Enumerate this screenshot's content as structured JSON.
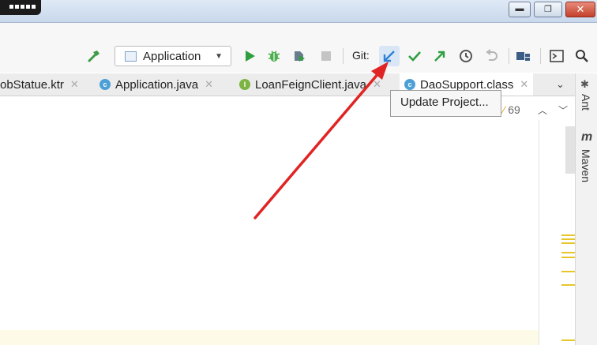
{
  "toolbar": {
    "run_config": "Application",
    "git_label": "Git:",
    "colors": {
      "run": "#2f9e3f",
      "debug": "#4caf50",
      "accent": "#3574d4"
    }
  },
  "icons": {
    "build": "hammer-icon",
    "run": "play-icon",
    "debug": "bug-icon",
    "coverage": "coverage-icon",
    "stop": "stop-icon",
    "update": "vcs-update-icon",
    "commit": "checkmark-icon",
    "push": "push-arrow-icon",
    "history": "history-clock-icon",
    "rollback": "rollback-icon",
    "project": "project-structure-icon",
    "terminal": "terminal-icon",
    "search": "search-icon"
  },
  "tabs": [
    {
      "label": "obStatue.ktr"
    },
    {
      "label": "Application.java",
      "type": "c"
    },
    {
      "label": "LoanFeignClient.java",
      "type": "I"
    },
    {
      "label": "DaoSupport.class",
      "type": "c"
    }
  ],
  "editor": {
    "inspection_count": "69"
  },
  "tooltip": {
    "text": "Update Project..."
  },
  "sidebar": {
    "ant": "Ant",
    "maven_icon": "m",
    "maven": "Maven"
  },
  "annotation_color": "#e02424"
}
